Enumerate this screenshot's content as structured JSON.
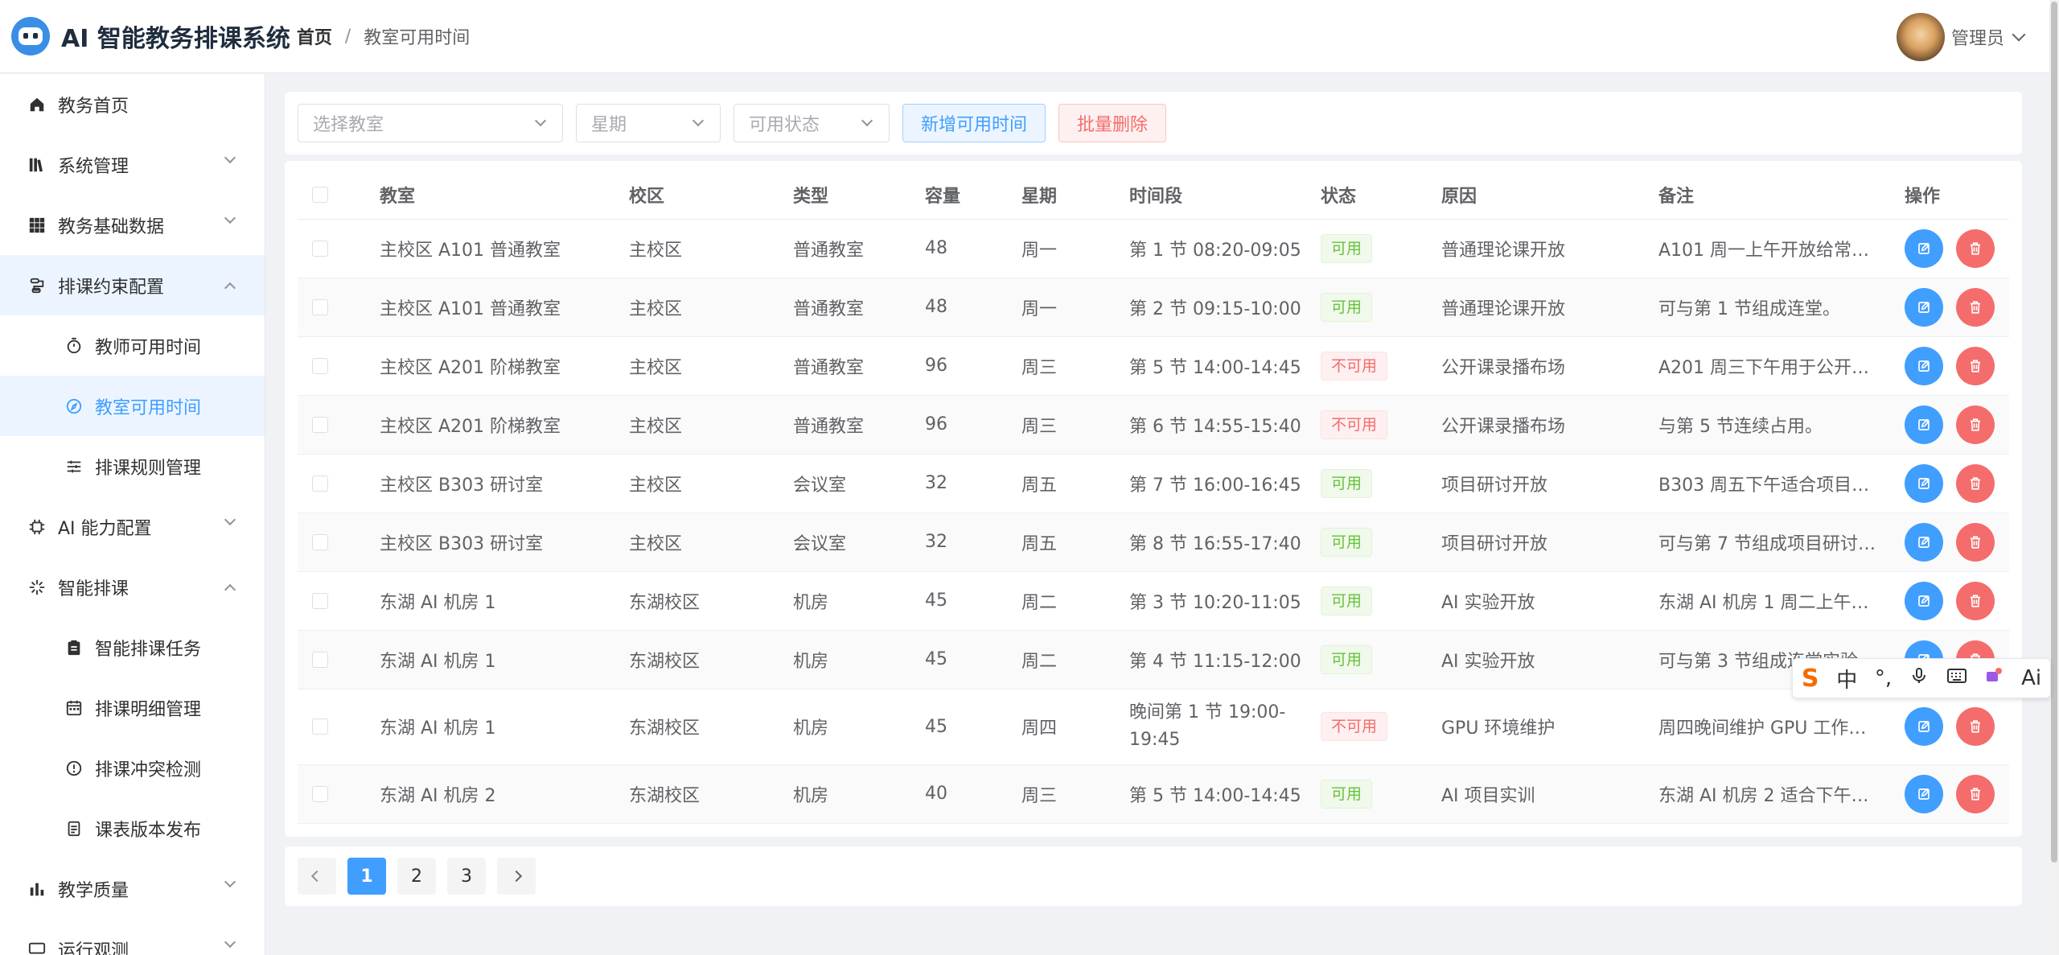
{
  "app": {
    "title": "AI 智能教务排课系统"
  },
  "breadcrumb": [
    "首页",
    "教室可用时间"
  ],
  "user": {
    "name": "管理员"
  },
  "sidebar": {
    "items": [
      {
        "label": "教务首页",
        "icon": "home-icon"
      },
      {
        "label": "系统管理",
        "icon": "library-icon"
      },
      {
        "label": "教务基础数据",
        "icon": "grid-icon"
      },
      {
        "label": "排课约束配置",
        "icon": "sliders-icon"
      },
      {
        "label": "教师可用时间",
        "icon": "timer-icon"
      },
      {
        "label": "教室可用时间",
        "icon": "compass-icon"
      },
      {
        "label": "排课规则管理",
        "icon": "settings-lines-icon"
      },
      {
        "label": "AI 能力配置",
        "icon": "cpu-icon"
      },
      {
        "label": "智能排课",
        "icon": "sparkle-icon"
      },
      {
        "label": "智能排课任务",
        "icon": "clipboard-icon"
      },
      {
        "label": "排课明细管理",
        "icon": "calendar-icon"
      },
      {
        "label": "排课冲突检测",
        "icon": "warning-icon"
      },
      {
        "label": "课表版本发布",
        "icon": "document-icon"
      },
      {
        "label": "教学质量",
        "icon": "bar-chart-icon"
      },
      {
        "label": "运行观测",
        "icon": "monitor-icon"
      }
    ]
  },
  "filters": {
    "classroom_placeholder": "选择教室",
    "weekday_placeholder": "星期",
    "status_placeholder": "可用状态",
    "add_label": "新增可用时间",
    "batch_delete_label": "批量删除"
  },
  "table": {
    "headers": [
      "教室",
      "校区",
      "类型",
      "容量",
      "星期",
      "时间段",
      "状态",
      "原因",
      "备注",
      "操作"
    ],
    "rows": [
      {
        "room": "主校区 A101 普通教室",
        "campus": "主校区",
        "type": "普通教室",
        "capacity": "48",
        "weekday": "周一",
        "slot": "第 1 节 08:20-09:05",
        "status": "可用",
        "reason": "普通理论课开放",
        "note": "A101 周一上午开放给常规…"
      },
      {
        "room": "主校区 A101 普通教室",
        "campus": "主校区",
        "type": "普通教室",
        "capacity": "48",
        "weekday": "周一",
        "slot": "第 2 节 09:15-10:00",
        "status": "可用",
        "reason": "普通理论课开放",
        "note": "可与第 1 节组成连堂。"
      },
      {
        "room": "主校区 A201 阶梯教室",
        "campus": "主校区",
        "type": "普通教室",
        "capacity": "96",
        "weekday": "周三",
        "slot": "第 5 节 14:00-14:45",
        "status": "不可用",
        "reason": "公开课录播布场",
        "note": "A201 周三下午用于公开课…"
      },
      {
        "room": "主校区 A201 阶梯教室",
        "campus": "主校区",
        "type": "普通教室",
        "capacity": "96",
        "weekday": "周三",
        "slot": "第 6 节 14:55-15:40",
        "status": "不可用",
        "reason": "公开课录播布场",
        "note": "与第 5 节连续占用。"
      },
      {
        "room": "主校区 B303 研讨室",
        "campus": "主校区",
        "type": "会议室",
        "capacity": "32",
        "weekday": "周五",
        "slot": "第 7 节 16:00-16:45",
        "status": "可用",
        "reason": "项目研讨开放",
        "note": "B303 周五下午适合项目评…"
      },
      {
        "room": "主校区 B303 研讨室",
        "campus": "主校区",
        "type": "会议室",
        "capacity": "32",
        "weekday": "周五",
        "slot": "第 8 节 16:55-17:40",
        "status": "可用",
        "reason": "项目研讨开放",
        "note": "可与第 7 节组成项目研讨…"
      },
      {
        "room": "东湖 AI 机房 1",
        "campus": "东湖校区",
        "type": "机房",
        "capacity": "45",
        "weekday": "周二",
        "slot": "第 3 节 10:20-11:05",
        "status": "可用",
        "reason": "AI 实验开放",
        "note": "东湖 AI 机房 1 周二上午开…"
      },
      {
        "room": "东湖 AI 机房 1",
        "campus": "东湖校区",
        "type": "机房",
        "capacity": "45",
        "weekday": "周二",
        "slot": "第 4 节 11:15-12:00",
        "status": "可用",
        "reason": "AI 实验开放",
        "note": "可与第 3 节组成连堂实验"
      },
      {
        "room": "东湖 AI 机房 1",
        "campus": "东湖校区",
        "type": "机房",
        "capacity": "45",
        "weekday": "周四",
        "slot": "晚间第 1 节 19:00-19:45",
        "status": "不可用",
        "reason": "GPU 环境维护",
        "note": "周四晚间维护 GPU 工作站…"
      },
      {
        "room": "东湖 AI 机房 2",
        "campus": "东湖校区",
        "type": "机房",
        "capacity": "40",
        "weekday": "周三",
        "slot": "第 5 节 14:00-14:45",
        "status": "可用",
        "reason": "AI 项目实训",
        "note": "东湖 AI 机房 2 适合下午项…"
      }
    ]
  },
  "pagination": {
    "pages": [
      "1",
      "2",
      "3"
    ],
    "current": "1"
  },
  "ime": {
    "mode": "中",
    "punct": "°,",
    "ai": "Ai"
  },
  "colors": {
    "primary": "#409eff",
    "danger": "#f56c6c",
    "success": "#67c23a"
  }
}
